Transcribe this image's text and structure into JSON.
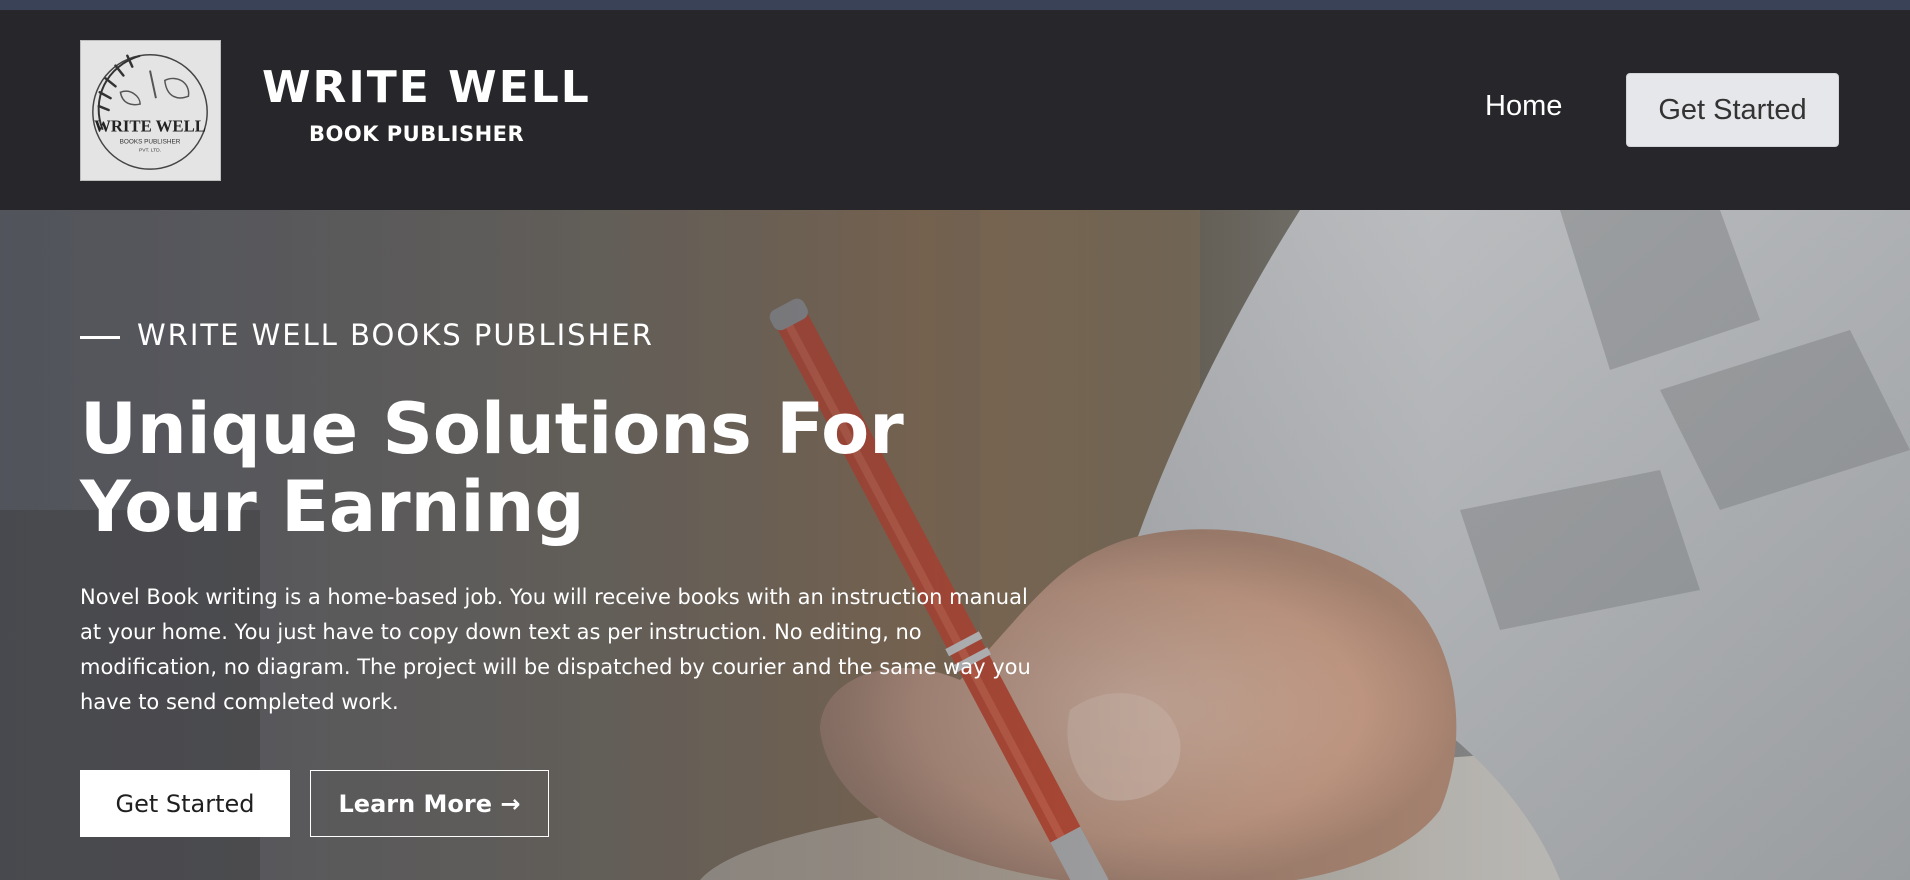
{
  "brand": {
    "logo_text": "WRITE WELL",
    "logo_subtext": "BOOKS PUBLISHER",
    "logo_small": "PVT. LTD.",
    "title": "WRITE WELL",
    "subtitle": "BOOK PUBLISHER"
  },
  "nav": {
    "home_label": "Home",
    "cta_label": "Get Started"
  },
  "hero": {
    "eyebrow": "WRITE WELL BOOKS PUBLISHER",
    "title": "Unique Solutions For Your Earning",
    "description": "Novel Book writing is a home-based job. You will receive books with an instruction manual at your home. You just have to copy down text as per instruction. No editing, no modification, no diagram. The project will be dispatched by courier and the same way you have to send completed work.",
    "primary_button": "Get Started",
    "secondary_button": "Learn More →"
  },
  "colors": {
    "top_strip": "#3a4258",
    "navbar_bg": "#27272b",
    "nav_button_bg": "#e6e7ea",
    "pen_accent": "#c8482e"
  },
  "icons": {
    "eyebrow_line": "horizontal-line-icon",
    "learn_more_arrow": "arrow-right-icon"
  }
}
